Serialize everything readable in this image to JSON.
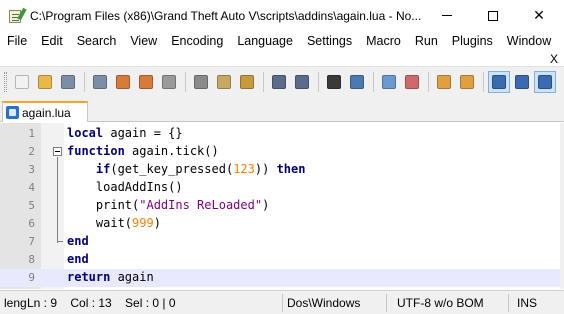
{
  "window": {
    "title": "C:\\Program Files (x86)\\Grand Theft Auto V\\scripts\\addins\\again.lua - No...",
    "minimize_glyph": "—",
    "maximize_glyph": "☐",
    "close_glyph": "✕"
  },
  "menu": {
    "items": [
      "File",
      "Edit",
      "Search",
      "View",
      "Encoding",
      "Language",
      "Settings",
      "Macro",
      "Run",
      "Plugins",
      "Window",
      "?"
    ],
    "doc_close": "X"
  },
  "toolbar": {
    "buttons": [
      {
        "name": "new-file-icon",
        "color": "#f2f2f2"
      },
      {
        "name": "open-file-icon",
        "color": "#e8b84a"
      },
      {
        "name": "save-icon",
        "color": "#7c8ea6"
      },
      {
        "name": "save-all-icon",
        "color": "#7c8ea6"
      },
      {
        "name": "close-icon",
        "color": "#d87a3a"
      },
      {
        "name": "close-all-icon",
        "color": "#d87a3a"
      },
      {
        "name": "print-icon",
        "color": "#9a9a9a"
      },
      {
        "name": "cut-icon",
        "color": "#8a8a8a"
      },
      {
        "name": "copy-icon",
        "color": "#c8a860"
      },
      {
        "name": "paste-icon",
        "color": "#c89a40"
      },
      {
        "name": "undo-icon",
        "color": "#5a6b8c"
      },
      {
        "name": "redo-icon",
        "color": "#5a6b8c"
      },
      {
        "name": "find-icon",
        "color": "#3a3a3a"
      },
      {
        "name": "replace-icon",
        "color": "#4a7ab0"
      },
      {
        "name": "zoom-in-icon",
        "color": "#6a9ad0"
      },
      {
        "name": "zoom-out-icon",
        "color": "#d06a6a"
      },
      {
        "name": "sync-vertical-icon",
        "color": "#e0a040"
      },
      {
        "name": "sync-horizontal-icon",
        "color": "#e0a040"
      },
      {
        "name": "word-wrap-icon",
        "color": "#3a6ab0"
      },
      {
        "name": "show-all-chars-icon",
        "color": "#3a6ab0"
      },
      {
        "name": "indent-guide-icon",
        "color": "#3a6ab0"
      }
    ]
  },
  "tabs": [
    {
      "label": "again.lua"
    }
  ],
  "editor": {
    "lines": [
      {
        "n": "1",
        "code": "local again = {}"
      },
      {
        "n": "2",
        "code": "function again.tick()"
      },
      {
        "n": "3",
        "code": "    if(get_key_pressed(123)) then"
      },
      {
        "n": "4",
        "code": "    loadAddIns()"
      },
      {
        "n": "5",
        "code": "    print(\"AddIns ReLoaded\")"
      },
      {
        "n": "6",
        "code": "    wait(999)"
      },
      {
        "n": "7",
        "code": "end"
      },
      {
        "n": "8",
        "code": "end"
      },
      {
        "n": "9",
        "code": "return again"
      }
    ],
    "current_line": "9"
  },
  "status": {
    "lang": "leng",
    "position": "Ln : 9    Col : 13    Sel : 0 | 0",
    "eol": "Dos\\Windows",
    "encoding": "UTF-8 w/o BOM",
    "mode": "INS"
  },
  "colors": {
    "keyword": "#00007f",
    "string": "#7f007f",
    "number": "#ff8000",
    "tab_accent": "#f9a52a",
    "current_line_bg": "#e8e8ff"
  }
}
